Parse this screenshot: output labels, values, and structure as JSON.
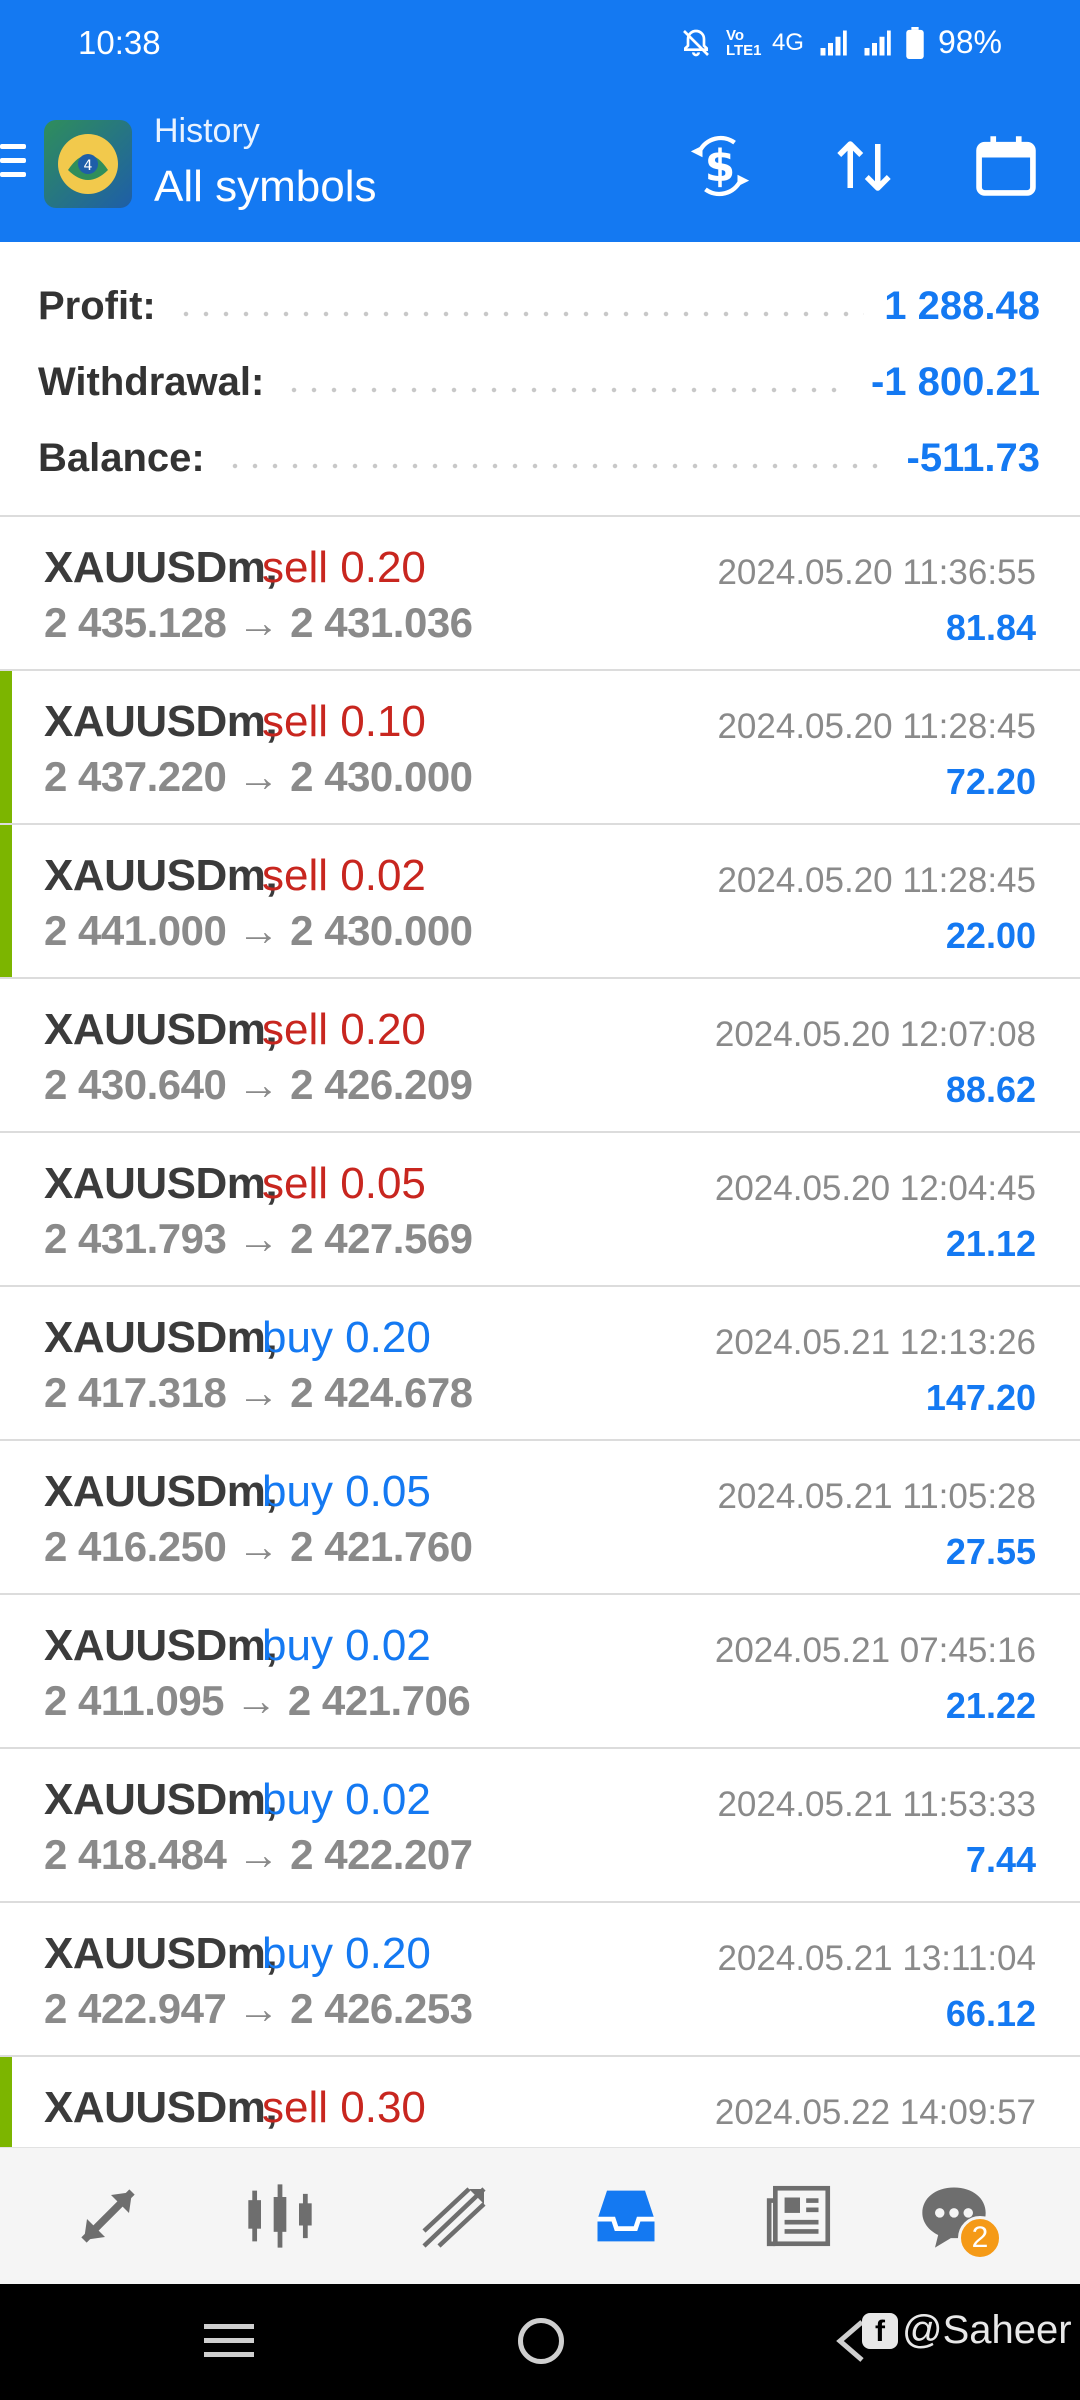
{
  "status_bar": {
    "time": "10:38",
    "network": "4G",
    "volte": "Vo LTE1",
    "battery": "98%"
  },
  "app_bar": {
    "title_small": "History",
    "title_big": "All symbols",
    "icons": [
      "menu-icon",
      "metatrader-logo",
      "balance-operations-icon",
      "sort-icon",
      "calendar-icon"
    ]
  },
  "summary": {
    "profit_label": "Profit:",
    "profit_value": "1 288.48",
    "withdrawal_label": "Withdrawal:",
    "withdrawal_value": "-1 800.21",
    "balance_label": "Balance:",
    "balance_value": "-511.73"
  },
  "deals": [
    {
      "symbol": "XAUUSDm,",
      "type": "sell 0.20",
      "side": "sell",
      "prices": "2 435.128 → 2 431.036",
      "time": "2024.05.20 11:36:55",
      "profit": "81.84",
      "marker": false
    },
    {
      "symbol": "XAUUSDm,",
      "type": "sell 0.10",
      "side": "sell",
      "prices": "2 437.220 → 2 430.000",
      "time": "2024.05.20 11:28:45",
      "profit": "72.20",
      "marker": true
    },
    {
      "symbol": "XAUUSDm,",
      "type": "sell 0.02",
      "side": "sell",
      "prices": "2 441.000 → 2 430.000",
      "time": "2024.05.20 11:28:45",
      "profit": "22.00",
      "marker": true
    },
    {
      "symbol": "XAUUSDm,",
      "type": "sell 0.20",
      "side": "sell",
      "prices": "2 430.640 → 2 426.209",
      "time": "2024.05.20 12:07:08",
      "profit": "88.62",
      "marker": false
    },
    {
      "symbol": "XAUUSDm,",
      "type": "sell 0.05",
      "side": "sell",
      "prices": "2 431.793 → 2 427.569",
      "time": "2024.05.20 12:04:45",
      "profit": "21.12",
      "marker": false
    },
    {
      "symbol": "XAUUSDm,",
      "type": "buy 0.20",
      "side": "buy",
      "prices": "2 417.318 → 2 424.678",
      "time": "2024.05.21 12:13:26",
      "profit": "147.20",
      "marker": false
    },
    {
      "symbol": "XAUUSDm,",
      "type": "buy 0.05",
      "side": "buy",
      "prices": "2 416.250 → 2 421.760",
      "time": "2024.05.21 11:05:28",
      "profit": "27.55",
      "marker": false
    },
    {
      "symbol": "XAUUSDm,",
      "type": "buy 0.02",
      "side": "buy",
      "prices": "2 411.095 → 2 421.706",
      "time": "2024.05.21 07:45:16",
      "profit": "21.22",
      "marker": false
    },
    {
      "symbol": "XAUUSDm,",
      "type": "buy 0.02",
      "side": "buy",
      "prices": "2 418.484 → 2 422.207",
      "time": "2024.05.21 11:53:33",
      "profit": "7.44",
      "marker": false
    },
    {
      "symbol": "XAUUSDm,",
      "type": "buy 0.20",
      "side": "buy",
      "prices": "2 422.947 → 2 426.253",
      "time": "2024.05.21 13:11:04",
      "profit": "66.12",
      "marker": false
    },
    {
      "symbol": "XAUUSDm,",
      "type": "sell 0.30",
      "side": "sell",
      "prices": "",
      "time": "2024.05.22 14:09:57",
      "profit": "",
      "marker": true
    }
  ],
  "bottom_nav": {
    "items": [
      "quotes-icon",
      "chart-icon",
      "trade-icon",
      "history-icon",
      "news-icon",
      "chat-icon"
    ],
    "active": "history-icon",
    "chat_badge": "2"
  },
  "watermark": {
    "text": "@Saheer"
  },
  "colors": {
    "accent": "#1479f2",
    "sell": "#c8261f",
    "marker": "#7cb500"
  }
}
